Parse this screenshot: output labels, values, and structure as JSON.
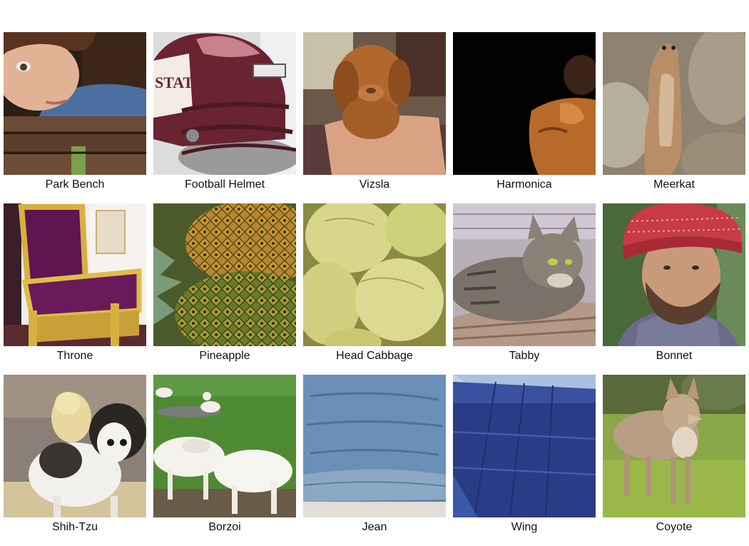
{
  "tiles": [
    {
      "label": "Park Bench",
      "subject": "woman resting head on wooden park bench"
    },
    {
      "label": "Football Helmet",
      "subject": "maroon football helmet with STATE logo"
    },
    {
      "label": "Vizsla",
      "subject": "newborn vizsla puppy held in hands"
    },
    {
      "label": "Harmonica",
      "subject": "person playing harmonica in dark"
    },
    {
      "label": "Meerkat",
      "subject": "meerkat standing upright on rocks"
    },
    {
      "label": "Throne",
      "subject": "gold and purple velvet throne"
    },
    {
      "label": "Pineapple",
      "subject": "pile of pineapples"
    },
    {
      "label": "Head Cabbage",
      "subject": "pile of green cabbages"
    },
    {
      "label": "Tabby",
      "subject": "tabby cat lying in basket"
    },
    {
      "label": "Bonnet",
      "subject": "bearded man wearing red knit hat"
    },
    {
      "label": "Shih-Tzu",
      "subject": "two shih-tzu dogs on pavement"
    },
    {
      "label": "Borzoi",
      "subject": "white borzoi dogs on grass"
    },
    {
      "label": "Jean",
      "subject": "close-up of blue denim jeans"
    },
    {
      "label": "Wing",
      "subject": "blue airplane wing against sky"
    },
    {
      "label": "Coyote",
      "subject": "coyote standing in grass"
    }
  ],
  "helmet_text": "STATE"
}
